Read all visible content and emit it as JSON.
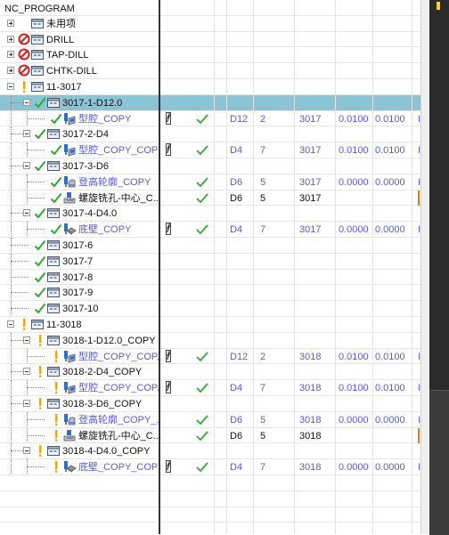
{
  "root_label": "NC_PROGRAM",
  "rows": [
    {
      "label": "未用项",
      "kind": "group",
      "level": 0,
      "expand": "plus",
      "status": "none",
      "icon": "group"
    },
    {
      "label": "DRILL",
      "kind": "group",
      "level": 0,
      "expand": "plus",
      "status": "forbid",
      "icon": "group"
    },
    {
      "label": "TAP-DILL",
      "kind": "group",
      "level": 0,
      "expand": "plus",
      "status": "forbid",
      "icon": "group"
    },
    {
      "label": "CHTK-DILL",
      "kind": "group",
      "level": 0,
      "expand": "plus",
      "status": "forbid",
      "icon": "group"
    },
    {
      "label": "11-3017",
      "kind": "group",
      "level": 0,
      "expand": "minus",
      "status": "warn",
      "icon": "group"
    },
    {
      "label": "3017-1-D12.0",
      "kind": "group",
      "level": 1,
      "expand": "minus",
      "status": "check",
      "icon": "group",
      "selected": true
    },
    {
      "label": "型腔_COPY",
      "kind": "op",
      "level": 2,
      "status": "check",
      "icon": "cavity",
      "tool": true,
      "check": true,
      "cols": [
        "D12",
        "2",
        "3017",
        "0.0100",
        "0.0100",
        "I"
      ]
    },
    {
      "label": "3017-2-D4",
      "kind": "group",
      "level": 1,
      "expand": "minus",
      "status": "check",
      "icon": "group"
    },
    {
      "label": "型腔_COPY_COPY",
      "kind": "op",
      "level": 2,
      "status": "check",
      "icon": "cavity",
      "tool": true,
      "check": true,
      "cols": [
        "D4",
        "7",
        "3017",
        "0.0100",
        "0.0100",
        "I"
      ]
    },
    {
      "label": "3017-3-D6",
      "kind": "group",
      "level": 1,
      "expand": "minus",
      "status": "check",
      "icon": "group"
    },
    {
      "label": "登高轮廓_COPY",
      "kind": "op",
      "level": 2,
      "status": "check",
      "icon": "zlevel",
      "tool": false,
      "check": true,
      "cols": [
        "D6",
        "5",
        "3017",
        "0.0000",
        "0.0000",
        "I"
      ]
    },
    {
      "label": "螺旋铣孔-中心_C...",
      "kind": "op2",
      "level": 2,
      "status": "check",
      "icon": "helix",
      "tool": false,
      "check": true,
      "cols": [
        "D6",
        "5",
        "3017",
        "",
        "",
        ""
      ]
    },
    {
      "label": "3017-4-D4.0",
      "kind": "group",
      "level": 1,
      "expand": "minus",
      "status": "check",
      "icon": "group"
    },
    {
      "label": "底壁_COPY",
      "kind": "op",
      "level": 2,
      "status": "check",
      "icon": "floor",
      "tool": true,
      "check": true,
      "cols": [
        "D4",
        "7",
        "3017",
        "0.0000",
        "0.0000",
        "I"
      ]
    },
    {
      "label": "3017-6",
      "kind": "group",
      "level": 1,
      "status": "check",
      "icon": "group"
    },
    {
      "label": "3017-7",
      "kind": "group",
      "level": 1,
      "status": "check",
      "icon": "group"
    },
    {
      "label": "3017-8",
      "kind": "group",
      "level": 1,
      "status": "check",
      "icon": "group"
    },
    {
      "label": "3017-9",
      "kind": "group",
      "level": 1,
      "status": "check",
      "icon": "group"
    },
    {
      "label": "3017-10",
      "kind": "group",
      "level": 1,
      "status": "check",
      "icon": "group"
    },
    {
      "label": "11-3018",
      "kind": "group",
      "level": 0,
      "expand": "minus",
      "status": "warn",
      "icon": "group"
    },
    {
      "label": "3018-1-D12.0_COPY",
      "kind": "group",
      "level": 1,
      "expand": "minus",
      "status": "warn",
      "icon": "group"
    },
    {
      "label": "型腔_COPY_COP...",
      "kind": "op",
      "level": 2,
      "status": "warn",
      "icon": "cavity",
      "tool": true,
      "check": true,
      "cols": [
        "D12",
        "2",
        "3018",
        "0.0100",
        "0.0100",
        "I"
      ]
    },
    {
      "label": "3018-2-D4_COPY",
      "kind": "group",
      "level": 1,
      "expand": "minus",
      "status": "warn",
      "icon": "group"
    },
    {
      "label": "型腔_COPY_COP...",
      "kind": "op",
      "level": 2,
      "status": "warn",
      "icon": "cavity",
      "tool": true,
      "check": true,
      "cols": [
        "D4",
        "7",
        "3018",
        "0.0100",
        "0.0100",
        "I"
      ]
    },
    {
      "label": "3018-3-D6_COPY",
      "kind": "group",
      "level": 1,
      "expand": "minus",
      "status": "warn",
      "icon": "group"
    },
    {
      "label": "登高轮廓_COPY_...",
      "kind": "op",
      "level": 2,
      "status": "warn",
      "icon": "zlevel",
      "tool": false,
      "check": true,
      "cols": [
        "D6",
        "5",
        "3018",
        "0.0000",
        "0.0000",
        "I"
      ]
    },
    {
      "label": "螺旋铣孔-中心_C...",
      "kind": "op2",
      "level": 2,
      "status": "warn",
      "icon": "helix",
      "tool": false,
      "check": true,
      "cols": [
        "D6",
        "5",
        "3018",
        "",
        "",
        ""
      ]
    },
    {
      "label": "3018-4-D4.0_COPY",
      "kind": "group",
      "level": 1,
      "expand": "minus",
      "status": "warn",
      "icon": "group"
    },
    {
      "label": "底壁_COPY_COPY",
      "kind": "op",
      "level": 2,
      "status": "warn",
      "icon": "floor",
      "tool": true,
      "check": true,
      "cols": [
        "D4",
        "7",
        "3018",
        "0.0000",
        "0.0000",
        "I"
      ]
    }
  ],
  "colors": {
    "selected": "#8bc4d4",
    "op_text": "#5a5ad6",
    "check": "#2ea82e",
    "warn": "#f2a20a",
    "forbid": "#d62020",
    "dark_panel": "#2b2b2b"
  }
}
